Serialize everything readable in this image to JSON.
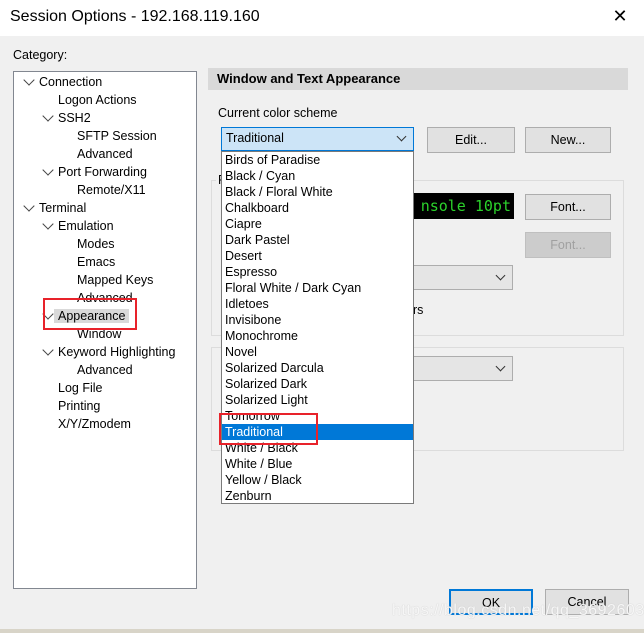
{
  "window": {
    "title": "Session Options - 192.168.119.160"
  },
  "category_label": "Category:",
  "tree": [
    {
      "label": "Connection",
      "level": 0,
      "expanded": true
    },
    {
      "label": "Logon Actions",
      "level": 1
    },
    {
      "label": "SSH2",
      "level": 1,
      "expanded": true
    },
    {
      "label": "SFTP Session",
      "level": 2
    },
    {
      "label": "Advanced",
      "level": 2
    },
    {
      "label": "Port Forwarding",
      "level": 1,
      "expanded": true
    },
    {
      "label": "Remote/X11",
      "level": 2
    },
    {
      "label": "Terminal",
      "level": 0,
      "expanded": true
    },
    {
      "label": "Emulation",
      "level": 1,
      "expanded": true
    },
    {
      "label": "Modes",
      "level": 2
    },
    {
      "label": "Emacs",
      "level": 2
    },
    {
      "label": "Mapped Keys",
      "level": 2
    },
    {
      "label": "Advanced",
      "level": 2
    },
    {
      "label": "Appearance",
      "level": 1,
      "expanded": true,
      "selected": true
    },
    {
      "label": "Window",
      "level": 2
    },
    {
      "label": "Keyword Highlighting",
      "level": 1,
      "expanded": true
    },
    {
      "label": "Advanced",
      "level": 2
    },
    {
      "label": "Log File",
      "level": 1
    },
    {
      "label": "Printing",
      "level": 1
    },
    {
      "label": "X/Y/Zmodem",
      "level": 1
    }
  ],
  "panel": {
    "header": "Window and Text Appearance",
    "color_scheme_label": "Current color scheme",
    "color_scheme_value": "Traditional",
    "edit_button": "Edit...",
    "new_button": "New...",
    "font_group_label_partial": "F",
    "font_preview": "nsole 10pt",
    "font_button": "Font...",
    "font_button_disabled": "Font...",
    "partial_text": "rs",
    "scheme_options": [
      "Birds of Paradise",
      "Black / Cyan",
      "Black / Floral White",
      "Chalkboard",
      "Ciapre",
      "Dark Pastel",
      "Desert",
      "Espresso",
      "Floral White / Dark Cyan",
      "Idletoes",
      "Invisibone",
      "Monochrome",
      "Novel",
      "Solarized Darcula",
      "Solarized Dark",
      "Solarized Light",
      "Tomorrow",
      "Traditional",
      "White / Black",
      "White / Blue",
      "Yellow / Black",
      "Zenburn"
    ],
    "selected_option": "Traditional"
  },
  "footer": {
    "ok": "OK",
    "cancel": "Cancel"
  },
  "watermark": "https://blog.csdn.net/qq_36926037",
  "colors": {
    "accent": "#0078d7",
    "highlight_box": "#e8222a",
    "preview_fg": "#2bd22b"
  }
}
